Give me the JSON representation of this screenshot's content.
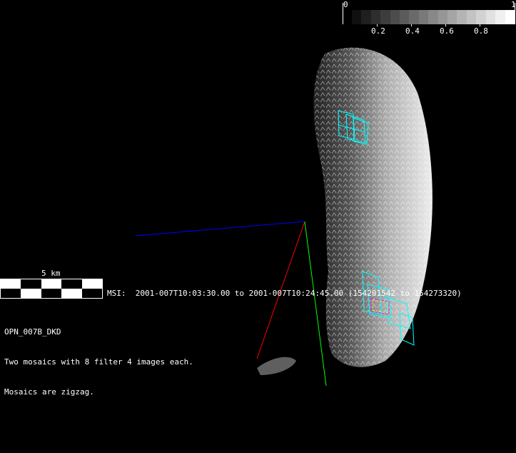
{
  "colorbar": {
    "min_label": "0",
    "max_label": "1",
    "tick_labels": [
      "0.2",
      "0.4",
      "0.6",
      "0.8"
    ],
    "steps": 17
  },
  "scale_bar": {
    "label": "5 km"
  },
  "msi": {
    "text": "MSI:  2001-007T10:03:30.00 to 2001-007T10:24:45.00 (154201542 to 154273320)"
  },
  "info": {
    "lines": [
      "OPN_007B_DKD",
      "Two mosaics with 8 filter 4 images each.",
      "Mosaics are zigzag."
    ]
  },
  "colors": {
    "axis_x": "#ff0000",
    "axis_y": "#00ff00",
    "axis_z": "#0000ff",
    "footprint": "#00ffff",
    "footprint_highlight": "#ff00ff",
    "footprint_highlight2": "#ffff00"
  }
}
